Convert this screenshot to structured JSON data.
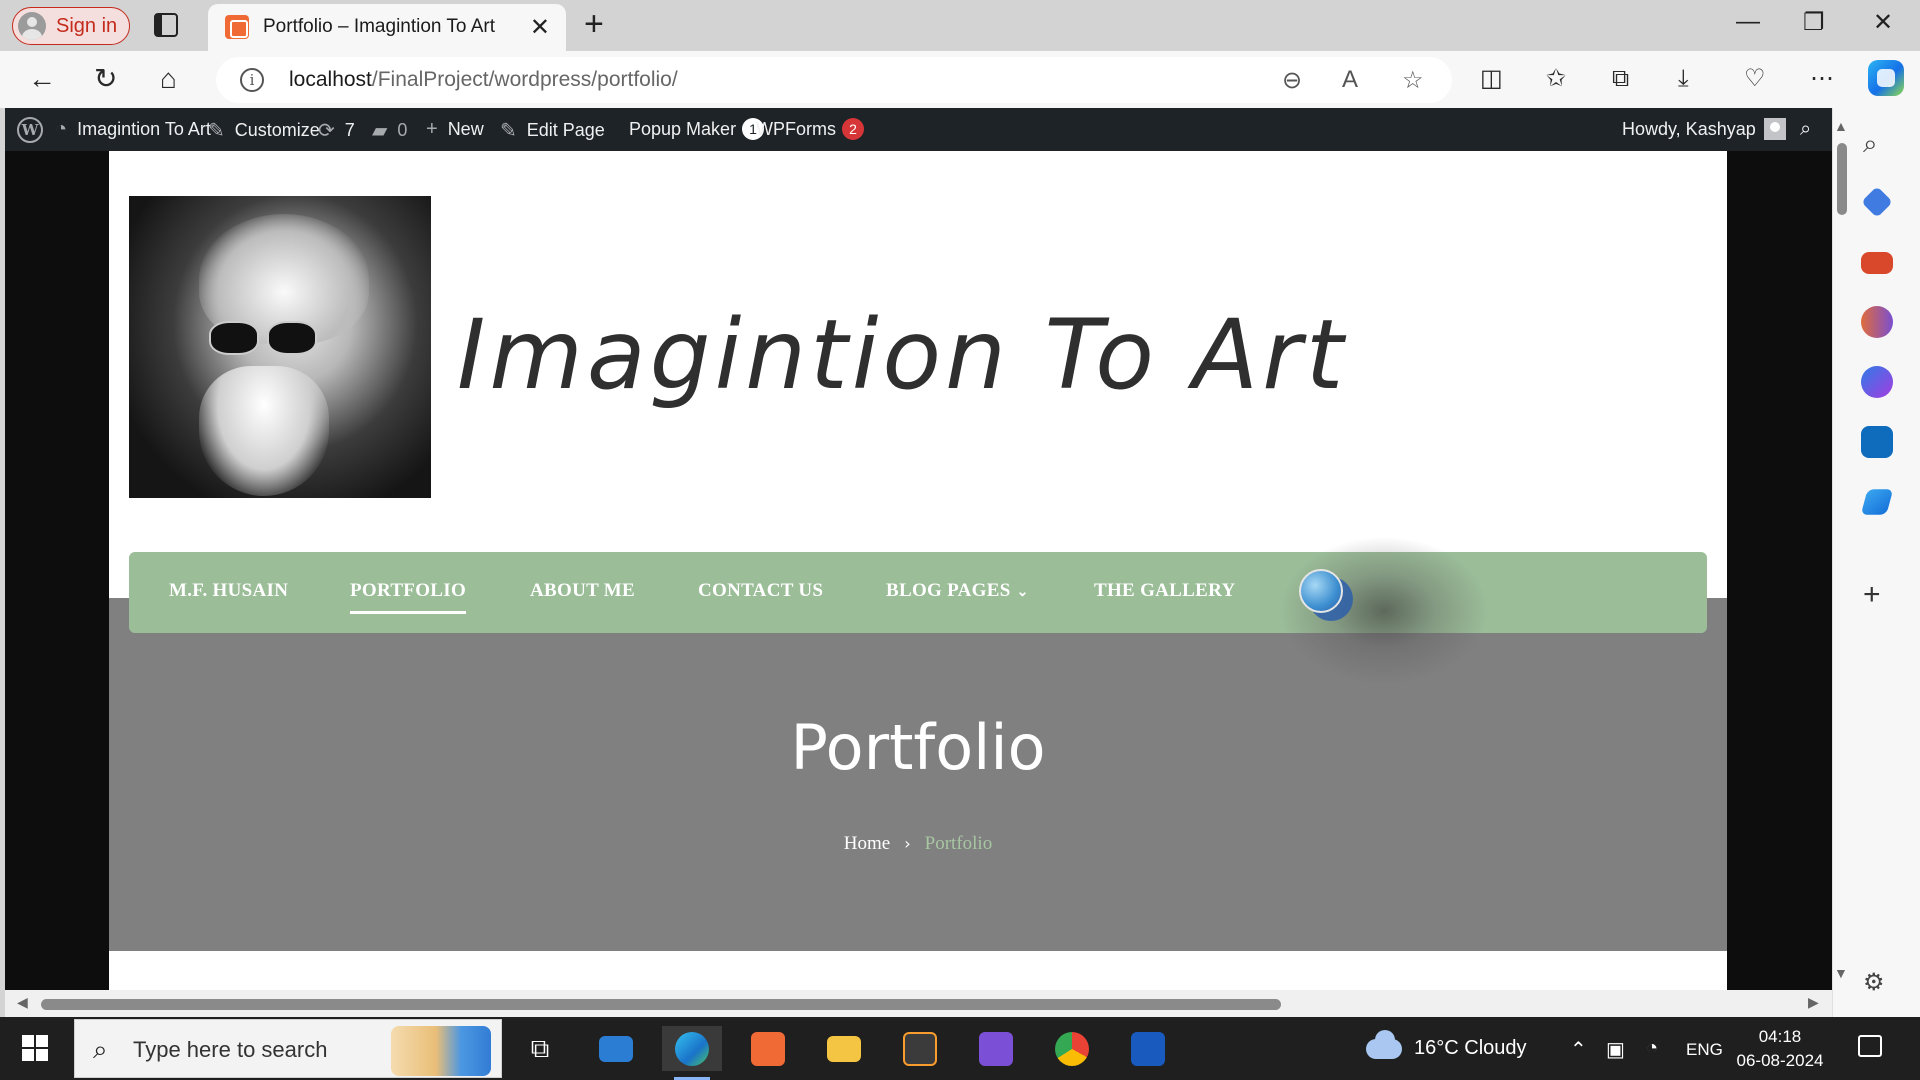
{
  "browser": {
    "signin_label": "Sign in",
    "tab_title": "Portfolio – Imagintion To Art",
    "tab_close": "✕",
    "new_tab": "+",
    "url_host": "localhost",
    "url_path": "/FinalProject/wordpress/portfolio/",
    "win_min": "—",
    "win_restore": "❐",
    "win_close": "✕"
  },
  "wp_admin_bar": {
    "site_name": "Imagintion To Art",
    "customize": "Customize",
    "updates_count": "7",
    "comments_count": "0",
    "new": "New",
    "edit_page": "Edit Page",
    "popup_maker": "Popup Maker",
    "popup_maker_badge": "1",
    "wpforms": "WPForms",
    "wpforms_badge": "2",
    "howdy": "Howdy, Kashyap"
  },
  "site": {
    "title": "Imagintion To Art",
    "nav": [
      {
        "label": "M.F. HUSAIN"
      },
      {
        "label": "PORTFOLIO"
      },
      {
        "label": "ABOUT ME"
      },
      {
        "label": "CONTACT US"
      },
      {
        "label": "BLOG PAGES"
      },
      {
        "label": "THE GALLERY"
      }
    ],
    "hero_title": "Portfolio",
    "breadcrumb_home": "Home",
    "breadcrumb_current": "Portfolio"
  },
  "taskbar": {
    "search_placeholder": "Type here to search",
    "weather": "16°C  Cloudy",
    "lang": "ENG",
    "time": "04:18",
    "date": "06-08-2024"
  },
  "colors": {
    "nav_green": "#9bbd98",
    "hero_gray": "#808080",
    "wp_bar": "#1d2327",
    "breadcrumb_current": "#a7c6a2",
    "accent_red": "#c42b1c"
  }
}
